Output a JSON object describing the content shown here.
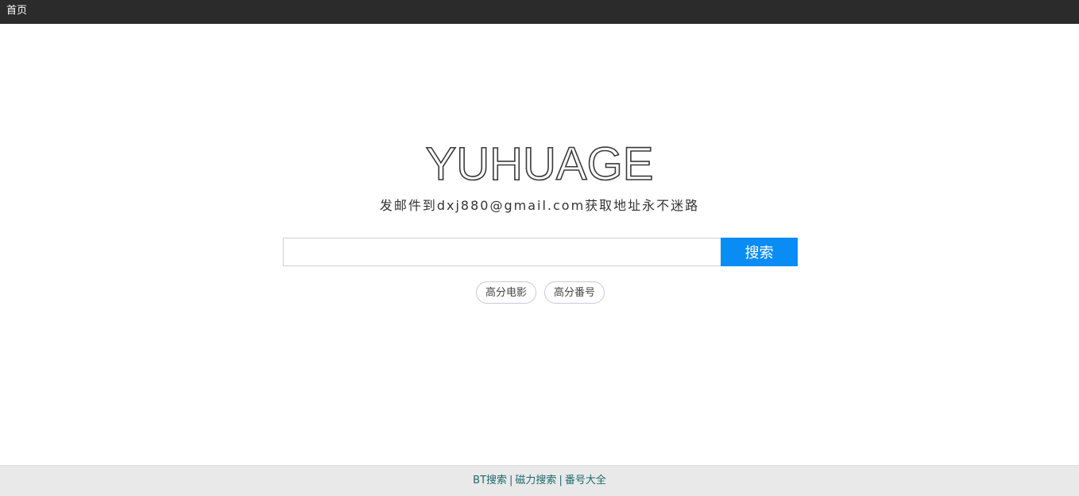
{
  "topbar": {
    "home_link": "首页",
    "background": "#2b2b2b"
  },
  "logo": {
    "text": "YUHUAGE"
  },
  "tagline": "发邮件到dxj880@gmail.com获取地址永不迷路",
  "search": {
    "value": "",
    "placeholder": "",
    "button_label": "搜索",
    "accent": "#0a8cf5"
  },
  "tags": [
    {
      "label": "高分电影"
    },
    {
      "label": "高分番号"
    }
  ],
  "footer": {
    "links": [
      {
        "label": "BT搜索"
      },
      {
        "label": "磁力搜索"
      },
      {
        "label": "番号大全"
      }
    ],
    "separator": "|"
  }
}
